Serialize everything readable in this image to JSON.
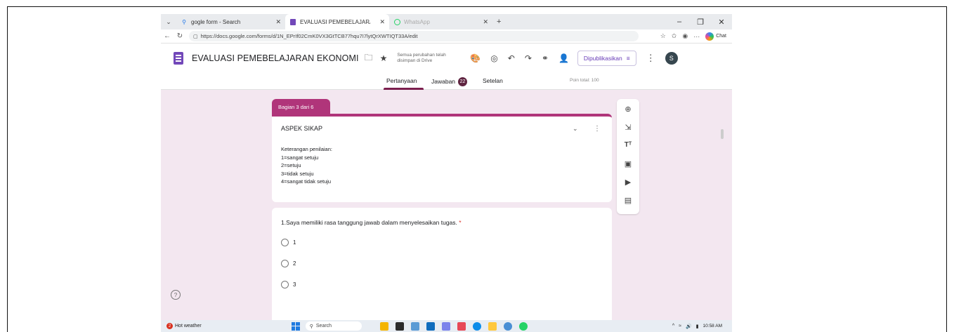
{
  "browser": {
    "tabs": [
      {
        "label": "gogle form - Search",
        "icon": "search-icon",
        "active": false
      },
      {
        "label": "EVALUASI PEMEBELAJARAN EKON",
        "icon": "forms-icon",
        "active": true
      },
      {
        "label": "WhatsApp",
        "icon": "whatsapp-icon",
        "active": false
      }
    ],
    "new_tab": "+",
    "url": "https://docs.google.com/forms/d/1N_EPrIf02CmK0VX3GtTCB77hqu7I7lytQrXWTIQT33A/edit",
    "chat_label": "Chat"
  },
  "forms": {
    "title": "EVALUASI PEMEBELAJARAN EKONOMI",
    "saved_note": "Semua perubahan telah disimpan di Drive",
    "publish_label": "Dipublikasikan",
    "avatar_initial": "S",
    "tabs": {
      "questions": "Pertanyaan",
      "responses": "Jawaban",
      "responses_count": "22",
      "settings": "Setelan"
    },
    "total_points": "Poin total: 100"
  },
  "section": {
    "tag": "Bagian 3 dari 6",
    "title": "ASPEK SIKAP",
    "description": [
      "Keterangan penilaian:",
      "1=sangat setuju",
      "2=setuju",
      "3=tidak setuju",
      "4=sangat tidak setuju"
    ]
  },
  "question": {
    "text": "1.Saya memiliki rasa tanggung jawab dalam menyelesaikan tugas.",
    "required_mark": "*",
    "options": [
      "1",
      "2",
      "3"
    ]
  },
  "taskbar": {
    "weather_label": "Hot weather",
    "weather_badge": "2",
    "search_placeholder": "Search",
    "time": "10:58 AM"
  },
  "colors": {
    "accent": "#b0357a",
    "purple": "#673ab7",
    "content_bg": "#f3e7f0"
  }
}
